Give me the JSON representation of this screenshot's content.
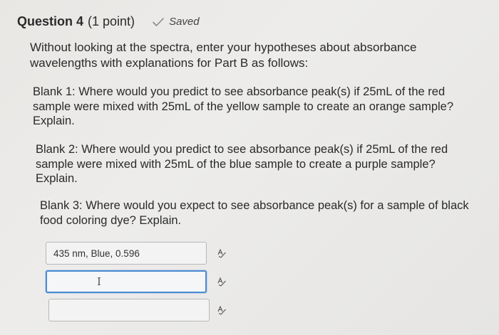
{
  "header": {
    "title": "Question 4",
    "points": "(1 point)",
    "saved_label": "Saved",
    "saved_icon": "check-icon"
  },
  "intro": "Without looking at the spectra, enter your hypotheses about absorbance wavelengths with explanations for Part B as follows:",
  "blanks": [
    {
      "text": "Blank 1: Where would you predict to see absorbance peak(s) if 25mL of the red sample were mixed with 25mL of the yellow sample to create an orange sample? Explain."
    },
    {
      "text": "Blank 2: Where would you predict to see absorbance peak(s) if 25mL of the red sample were mixed with 25mL of the blue sample to create a purple sample? Explain."
    },
    {
      "text": "Blank 3: Where would you expect to see absorbance peak(s) for a sample of black food coloring dye? Explain."
    }
  ],
  "answers": [
    {
      "value": "435 nm, Blue, 0.596",
      "icon": "spell-check-icon"
    },
    {
      "value": "",
      "icon": "spell-check-icon"
    },
    {
      "value": "",
      "icon": "spell-check-icon"
    }
  ],
  "colors": {
    "focus_border": "#4a8bd4",
    "text": "#2a2a2a"
  }
}
